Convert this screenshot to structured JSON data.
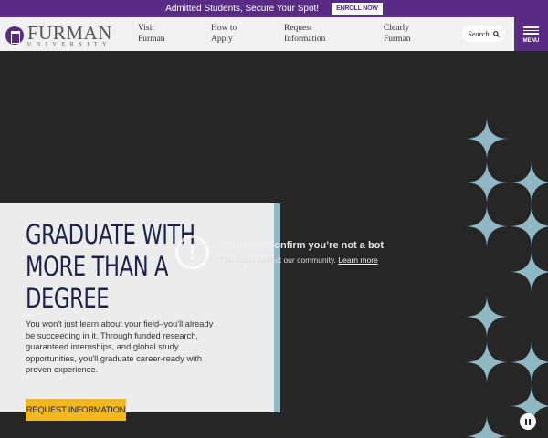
{
  "announcement": {
    "text": "Admitted Students, Secure Your Spot!",
    "button": "ENROLL NOW"
  },
  "logo": {
    "name": "FURMAN",
    "sub": "UNIVERSITY"
  },
  "nav": {
    "links": [
      [
        "Visit",
        "Furman"
      ],
      [
        "How to",
        "Apply"
      ],
      [
        "Request",
        "Information"
      ],
      [
        "Clearly",
        "Furman"
      ]
    ],
    "search": "Search",
    "menu": "MENU"
  },
  "hero": {
    "title": "GRADUATE WITH MORE THAN A DEGREE",
    "body": "You won't just learn about your field–you'll already be succeeding in it. Through funded research, guaranteed internships, and global study opportunities, you'll graduate career-ready with proven experience.",
    "cta": "REQUEST INFORMATION"
  },
  "overlay": {
    "title": "Sign in to confirm you’re not a bot",
    "subtitle": "This helps protect our community.",
    "link": "Learn more"
  },
  "colors": {
    "purple": "#582c83",
    "gold": "#f2b81c",
    "teal": "#8fb8c4",
    "navy": "#22204a"
  }
}
